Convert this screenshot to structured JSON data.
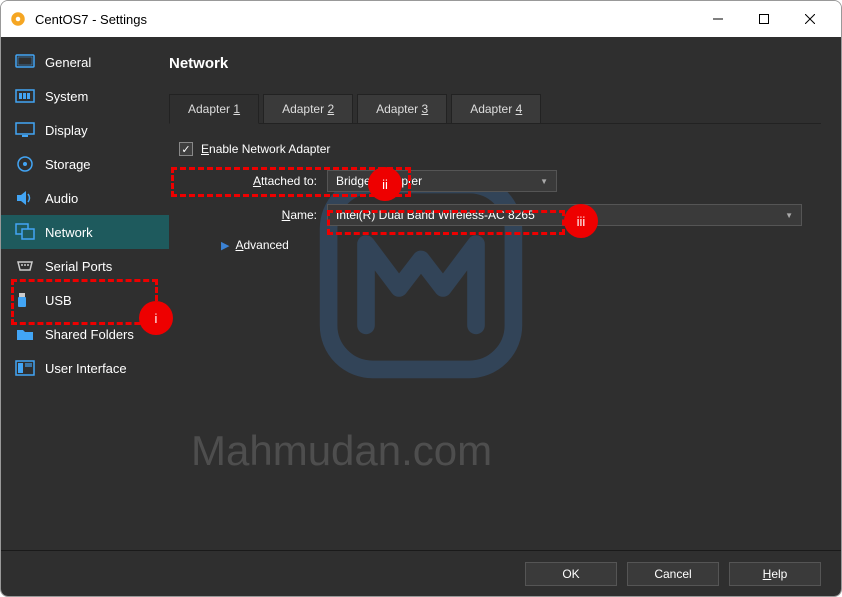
{
  "window": {
    "title": "CentOS7 - Settings"
  },
  "sidebar": {
    "items": [
      {
        "label": "General"
      },
      {
        "label": "System"
      },
      {
        "label": "Display"
      },
      {
        "label": "Storage"
      },
      {
        "label": "Audio"
      },
      {
        "label": "Network"
      },
      {
        "label": "Serial Ports"
      },
      {
        "label": "USB"
      },
      {
        "label": "Shared Folders"
      },
      {
        "label": "User Interface"
      }
    ]
  },
  "main": {
    "title": "Network",
    "tabs": [
      {
        "prefix": "Adapter ",
        "num": "1"
      },
      {
        "prefix": "Adapter ",
        "num": "2"
      },
      {
        "prefix": "Adapter ",
        "num": "3"
      },
      {
        "prefix": "Adapter ",
        "num": "4"
      }
    ],
    "enable_label_prefix": "E",
    "enable_label_rest": "nable Network Adapter",
    "attached_prefix": "A",
    "attached_rest": "ttached to:",
    "attached_value": "Bridged Adapter",
    "name_prefix": "N",
    "name_rest": "ame:",
    "name_value": "Intel(R) Dual Band Wireless-AC 8265",
    "advanced_prefix": "A",
    "advanced_rest": "dvanced"
  },
  "annotations": {
    "i": "i",
    "ii": "ii",
    "iii": "iii"
  },
  "buttons": {
    "ok": "OK",
    "cancel": "Cancel",
    "help_prefix": "H",
    "help_rest": "elp"
  },
  "watermark": "Mahmudan.com"
}
